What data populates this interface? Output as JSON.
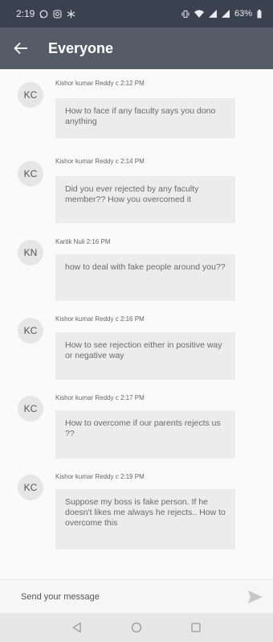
{
  "status_bar": {
    "time": "2:19",
    "battery": "63%"
  },
  "header": {
    "title": "Everyone"
  },
  "messages": [
    {
      "initials": "KC",
      "sender": "Kishor kumar Reddy c",
      "time": "2:12 PM",
      "text": "How to face if any faculty says you dono anything"
    },
    {
      "initials": "KC",
      "sender": "Kishor kumar Reddy c",
      "time": "2:14 PM",
      "text": "Did you ever rejected by any faculty member?? How you overcomed it"
    },
    {
      "initials": "KN",
      "sender": "Kartik Nuli",
      "time": "2:16 PM",
      "text": "how to deal with fake people around you??"
    },
    {
      "initials": "KC",
      "sender": "Kishor kumar Reddy c",
      "time": "2:16 PM",
      "text": "How to see rejection either in positive way or negative way"
    },
    {
      "initials": "KC",
      "sender": "Kishor kumar Reddy c",
      "time": "2:17 PM",
      "text": "How to overcome  if our parents rejects us ??"
    },
    {
      "initials": "KC",
      "sender": "Kishor kumar Reddy c",
      "time": "2:19 PM",
      "text": "Suppose my boss is fake person. If he doesn't likes me always he rejects.. How to overcome this"
    }
  ],
  "composer": {
    "placeholder": "Send your message",
    "value": ""
  },
  "icons": {
    "back": "arrow-left-icon",
    "send": "send-icon",
    "nav_back": "triangle-back-icon",
    "nav_home": "circle-home-icon",
    "nav_recents": "square-recents-icon"
  },
  "colors": {
    "status_bar": "#3a4250",
    "app_bar": "#555c68",
    "bubble": "#ececec",
    "avatar": "#e6e6e6"
  }
}
